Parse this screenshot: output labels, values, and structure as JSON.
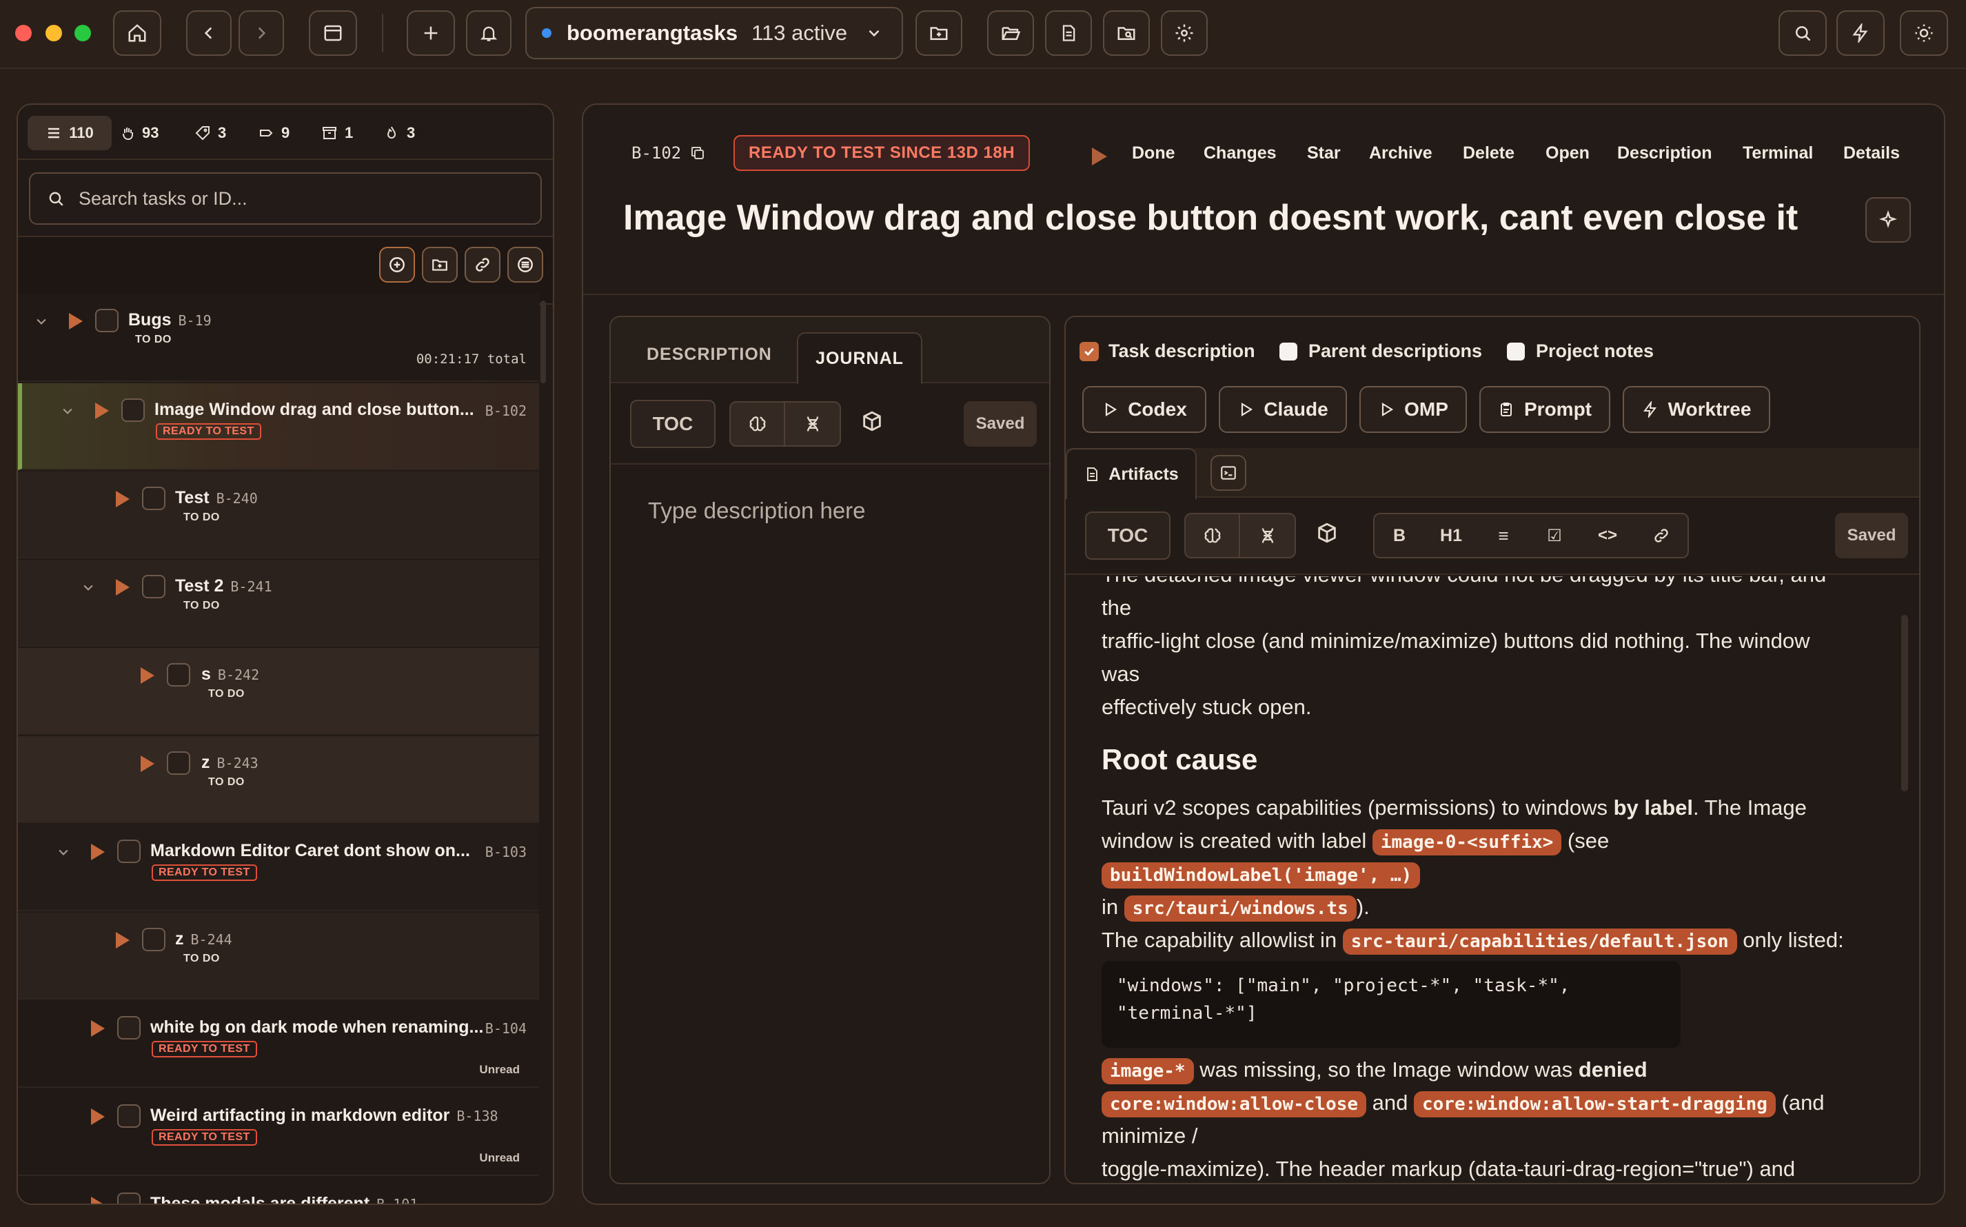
{
  "titlebar": {
    "project_name": "boomerangtasks",
    "active_count": "113 active"
  },
  "colors": {
    "accent": "#c5683c",
    "ready_to_test": "#e04f39",
    "traffic_red": "#ff5f57",
    "traffic_yellow": "#febc2e",
    "traffic_green": "#28c840",
    "status_dot": "#3a8ff0"
  },
  "sidebar": {
    "filters": [
      {
        "icon": "list-icon",
        "count": "110"
      },
      {
        "icon": "hand-icon",
        "count": "93"
      },
      {
        "icon": "tag-icon",
        "count": "3"
      },
      {
        "icon": "label-icon",
        "count": "9"
      },
      {
        "icon": "archive-icon",
        "count": "1"
      },
      {
        "icon": "flame-icon",
        "count": "3"
      }
    ],
    "search_placeholder": "Search tasks or ID...",
    "tasks": [
      {
        "name": "Bugs",
        "id": "B-19",
        "status": "TO DO",
        "total": "00:21:17 total"
      },
      {
        "name": "Image Window drag and close button...",
        "id": "B-102",
        "status": "READY TO TEST"
      },
      {
        "name": "Test",
        "id": "B-240",
        "status": "TO DO"
      },
      {
        "name": "Test 2",
        "id": "B-241",
        "status": "TO DO"
      },
      {
        "name": "s",
        "id": "B-242",
        "status": "TO DO"
      },
      {
        "name": "z",
        "id": "B-243",
        "status": "TO DO"
      },
      {
        "name": "Markdown Editor Caret dont show on...",
        "id": "B-103",
        "status": "READY TO TEST"
      },
      {
        "name": "z",
        "id": "B-244",
        "status": "TO DO"
      },
      {
        "name": "white bg on dark mode when renaming...",
        "id": "B-104",
        "status": "READY TO TEST",
        "badge": "Unread"
      },
      {
        "name": "Weird artifacting in markdown editor",
        "id": "B-138",
        "status": "READY TO TEST",
        "badge": "Unread"
      },
      {
        "name": "These modals are different",
        "id": "B-101"
      }
    ]
  },
  "detail": {
    "task_id": "B-102",
    "status_chip": "READY TO TEST SINCE 13D 18H",
    "actions": [
      "Done",
      "Changes",
      "Star",
      "Archive",
      "Delete",
      "Open",
      "Description",
      "Terminal",
      "Details"
    ],
    "title": "Image Window drag and close button doesnt work, cant even close it"
  },
  "left_editor": {
    "tabs": [
      "DESCRIPTION",
      "JOURNAL"
    ],
    "toc_label": "TOC",
    "saved_label": "Saved",
    "placeholder": "Type description here"
  },
  "right_pane": {
    "checkboxes": [
      {
        "label": "Task description",
        "checked": true
      },
      {
        "label": "Parent descriptions",
        "checked": false
      },
      {
        "label": "Project notes",
        "checked": false
      }
    ],
    "run_buttons": [
      "Codex",
      "Claude",
      "OMP",
      "Prompt",
      "Worktree"
    ],
    "artifacts_tab": "Artifacts",
    "toc_label": "TOC",
    "format": [
      "B",
      "H1",
      "≡",
      "☑",
      "<>",
      "🔗"
    ],
    "saved_label": "Saved",
    "content": {
      "p0_cut": "The detached image viewer window could not be dragged by its title bar, and",
      "p0_l2": "the",
      "p0_l3": "traffic-light close (and minimize/maximize) buttons did nothing. The window",
      "p0_l4": "was",
      "p0_l5": "effectively stuck open.",
      "h2": "Root cause",
      "p1_a": "Tauri v2 scopes capabilities (permissions) to windows ",
      "p1_b": "by label",
      "p1_c": ". The Image",
      "p1_d": "window is created with label ",
      "code1": "image-0-<suffix>",
      "p1_e": " (see",
      "code2": "buildWindowLabel('image', …)",
      "p1_f": "in ",
      "code3": "src/tauri/windows.ts",
      "p1_g": ").",
      "p2_a": "The capability allowlist in ",
      "code4": "src-tauri/capabilities/default.json",
      "p2_b": " only listed:",
      "block_l1": "\"windows\": [\"main\", \"project-*\", \"task-*\",",
      "block_l2": "\"terminal-*\"]",
      "code5": "image-*",
      "p3_a": " was missing, so the Image window was ",
      "p3_b": "denied",
      "code6": "core:window:allow-close",
      "p3_c": " and ",
      "code7": "core:window:allow-start-dragging",
      "p3_d": " (and",
      "p3_e": "minimize /",
      "p3_cut": "toggle-maximize). The header markup (data-tauri-drag-region=\"true\") and"
    }
  }
}
